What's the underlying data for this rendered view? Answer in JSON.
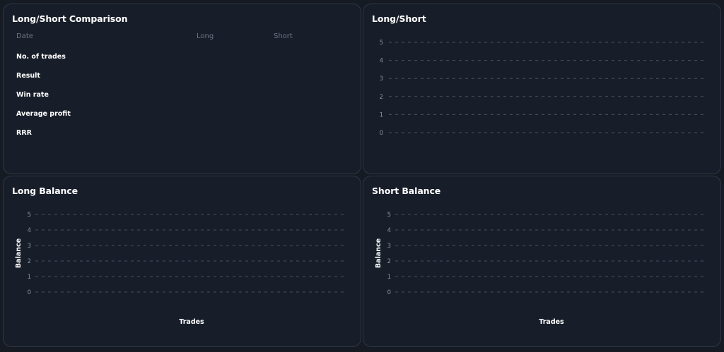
{
  "comparison": {
    "title": "Long/Short Comparison",
    "headers": [
      "Date",
      "Long",
      "Short"
    ],
    "rows": [
      "No. of trades",
      "Result",
      "Win rate",
      "Average profit",
      "RRR"
    ]
  },
  "long_short": {
    "title": "Long/Short"
  },
  "long_balance": {
    "title": "Long Balance"
  },
  "short_balance": {
    "title": "Short Balance"
  },
  "chart_data": [
    {
      "type": "bar",
      "title": "Long/Short",
      "xlabel": "",
      "ylabel": "",
      "ylim": [
        0,
        5
      ],
      "yticks": [
        0,
        1,
        2,
        3,
        4,
        5
      ],
      "grid": true,
      "series": []
    },
    {
      "type": "line",
      "title": "Long Balance",
      "xlabel": "Trades",
      "ylabel": "Balance",
      "ylim": [
        0,
        5
      ],
      "yticks": [
        0,
        1,
        2,
        3,
        4,
        5
      ],
      "grid": true,
      "series": []
    },
    {
      "type": "line",
      "title": "Short Balance",
      "xlabel": "Trades",
      "ylabel": "Balance",
      "ylim": [
        0,
        5
      ],
      "yticks": [
        0,
        1,
        2,
        3,
        4,
        5
      ],
      "grid": true,
      "series": []
    }
  ]
}
